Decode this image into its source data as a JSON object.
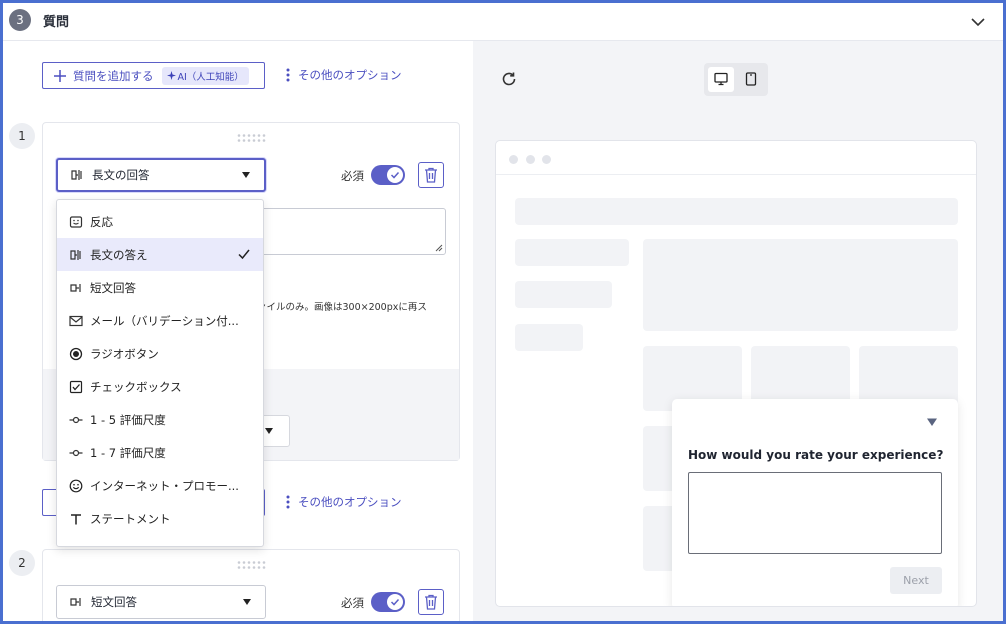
{
  "header": {
    "step_number": "3",
    "title": "質問"
  },
  "toolbar": {
    "add_question_label": "質問を追加する",
    "ai_badge_label": "AI（人工知能）",
    "more_options_label": "その他のオプション"
  },
  "question1": {
    "number": "1",
    "type_label": "長文の回答",
    "required_label": "必須",
    "helper_text": "ァイルのみ。画像は300×200pxに再ス"
  },
  "type_dropdown": {
    "items": [
      {
        "label": "反応",
        "icon": "reaction-icon"
      },
      {
        "label": "長文の答え",
        "icon": "long-text-icon",
        "selected": true
      },
      {
        "label": "短文回答",
        "icon": "short-text-icon"
      },
      {
        "label": "メール（バリデーション付...",
        "icon": "mail-icon"
      },
      {
        "label": "ラジオボタン",
        "icon": "radio-icon"
      },
      {
        "label": "チェックボックス",
        "icon": "checkbox-icon"
      },
      {
        "label": "1 - 5 評価尺度",
        "icon": "rating-scale-icon"
      },
      {
        "label": "1 - 7 評価尺度",
        "icon": "rating-scale-icon"
      },
      {
        "label": "インターネット・プロモー...",
        "icon": "smile-icon"
      },
      {
        "label": "ステートメント",
        "icon": "text-t-icon"
      }
    ]
  },
  "more_options_2_label": "その他のオプション",
  "question2": {
    "number": "2",
    "type_label": "短文回答",
    "required_label": "必須"
  },
  "preview": {
    "question_text": "How would you rate your experience?",
    "next_label": "Next"
  },
  "colors": {
    "accent": "#5b5fc7",
    "frame": "#4a6fd0",
    "preview_bg": "#f3f4f7"
  }
}
